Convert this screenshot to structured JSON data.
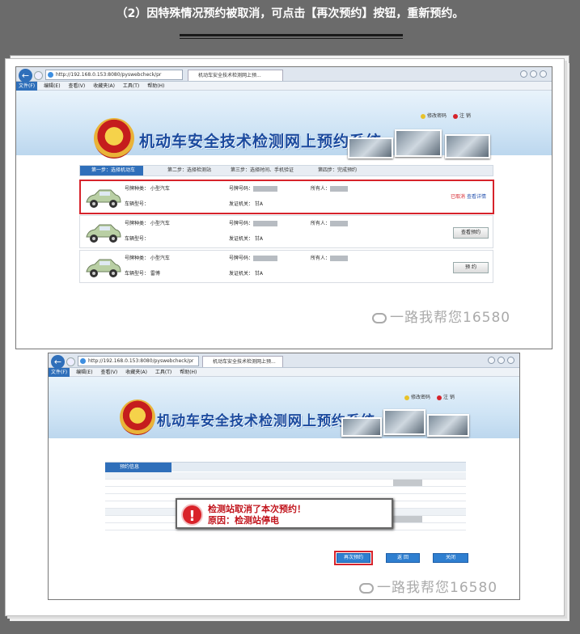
{
  "headline": "（2）因特殊情况预约被取消，可点击【再次预约】按钮，重新预约。",
  "browser": {
    "url1": "http://192.168.0.153:8080/pyswebcheck/pr",
    "url2": "http://192.168.0.153:8080/pyswebcheck/pr",
    "tab": "机动车安全技术检测网上预...",
    "menu": [
      "文件(F)",
      "编辑(E)",
      "查看(V)",
      "收藏夹(A)",
      "工具(T)",
      "帮助(H)"
    ]
  },
  "site": {
    "title": "机动车安全技术检测网上预约系统",
    "link_password": "修改密码",
    "link_logout": "注 销"
  },
  "steps": [
    "第一步：选择机动车",
    "第二步：选择检测站",
    "第三步：选择时间、手机验证",
    "第四步：完成预约"
  ],
  "vehicles": [
    {
      "plate_type": "号牌种类： 小型汽车",
      "plate_no": "号牌号码：",
      "owner": "所有人：",
      "model": "车辆型号：",
      "office": "发证机关： 甘A",
      "action1": "已取消",
      "action2": "查看详情"
    },
    {
      "plate_type": "号牌种类： 小型汽车",
      "plate_no": "号牌号码：",
      "owner": "所有人：",
      "model": "车辆型号：",
      "office": "发证机关： 甘A",
      "action": "查看预约"
    },
    {
      "plate_type": "号牌种类： 小型汽车",
      "plate_no": "号牌号码：",
      "owner": "所有人：",
      "model": "车辆型号： 雷博",
      "office": "发证机关： 甘A",
      "action": "预 约"
    }
  ],
  "detail": {
    "tab": "预约信息",
    "dialog_line1": "检测站取消了本次预约！",
    "dialog_line2": "原因：检测站停电",
    "btn_again": "再次预约",
    "btn_back": "返 回",
    "btn_close": "关闭"
  },
  "watermark": "一路我帮您16580",
  "colors": {
    "brand_blue": "#2f6fba",
    "highlight_red": "#d6232b"
  }
}
